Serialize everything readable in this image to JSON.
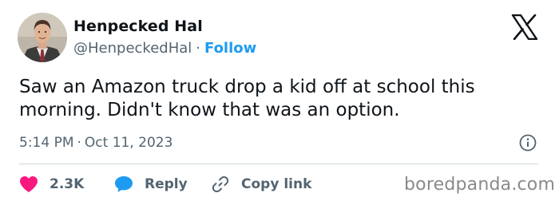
{
  "author": {
    "display_name": "Henpecked Hal",
    "handle": "@HenpeckedHal",
    "separator": "·",
    "follow_label": "Follow"
  },
  "tweet": {
    "text": "Saw an Amazon truck drop a kid off at school this morning. Didn't know that was an option.",
    "time": "5:14 PM",
    "separator": "·",
    "date": "Oct 11, 2023"
  },
  "actions": {
    "like_count": "2.3K",
    "reply_label": "Reply",
    "copy_link_label": "Copy link"
  },
  "watermark": "boredpanda.com",
  "colors": {
    "accent": "#1d9bf0",
    "like": "#f91880",
    "text_primary": "#0f1419",
    "text_secondary": "#536471",
    "divider": "#cfd9de"
  },
  "icons": [
    "avatar",
    "x-logo-icon",
    "info-icon",
    "heart-icon",
    "speech-bubble-icon",
    "link-icon"
  ]
}
